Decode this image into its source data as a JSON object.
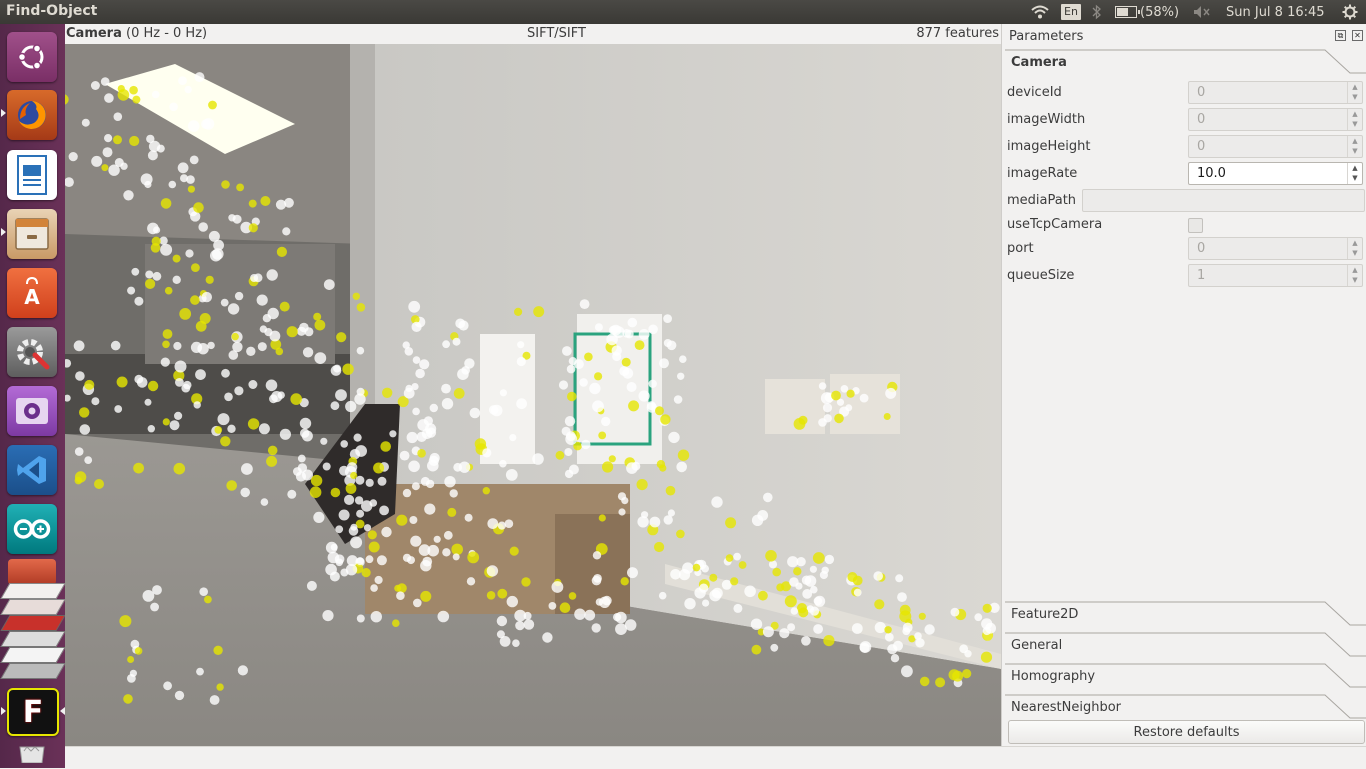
{
  "topbar": {
    "app_title": "Find-Object",
    "keyboard_layout": "En",
    "battery_percent": "(58%)",
    "clock": "Sun Jul 8 16:45"
  },
  "launcher": {
    "apps": [
      {
        "name": "Ubuntu Dash",
        "icon": "ubuntu-logo",
        "color": "#8a3d76"
      },
      {
        "name": "Firefox",
        "icon": "firefox",
        "color": "#e66000"
      },
      {
        "name": "LibreOffice Writer",
        "icon": "writer",
        "color": "#2a71b8"
      },
      {
        "name": "Files",
        "icon": "file-cabinet",
        "color": "#c9733a"
      },
      {
        "name": "Ubuntu Software",
        "icon": "shopping-bag",
        "color": "#e2552b"
      },
      {
        "name": "System Settings",
        "icon": "gear-wrench",
        "color": "#6d6d6d"
      },
      {
        "name": "Webcam",
        "icon": "camera",
        "color": "#8e44ad"
      },
      {
        "name": "Visual Studio Code",
        "icon": "vscode",
        "color": "#0f6fbf"
      },
      {
        "name": "Arduino",
        "icon": "arduino",
        "color": "#00979c"
      },
      {
        "name": "Workspace stack",
        "icon": "stack",
        "color": "#d04030"
      },
      {
        "name": "Find-Object",
        "icon": "find-object",
        "color": "#111111"
      },
      {
        "name": "Trash",
        "icon": "trash",
        "color": "#cccccc"
      }
    ]
  },
  "camera_panel": {
    "title_name": "Camera",
    "title_rate": "(0 Hz - 0 Hz)",
    "detector": "SIFT/SIFT",
    "features": "877 features",
    "feature_colors": {
      "matched": "#e6e600",
      "unmatched": "#ffffff",
      "object_box": "#2aa37e"
    }
  },
  "parameters": {
    "title": "Parameters",
    "open_section": "Camera",
    "rows": [
      {
        "label": "deviceId",
        "value": "0",
        "kind": "spin"
      },
      {
        "label": "imageWidth",
        "value": "0",
        "kind": "spin"
      },
      {
        "label": "imageHeight",
        "value": "0",
        "kind": "spin"
      },
      {
        "label": "imageRate",
        "value": "10.0",
        "kind": "spin-active"
      },
      {
        "label": "mediaPath",
        "value": "",
        "kind": "text"
      },
      {
        "label": "useTcpCamera",
        "value": "",
        "kind": "check"
      },
      {
        "label": "port",
        "value": "0",
        "kind": "spin"
      },
      {
        "label": "queueSize",
        "value": "1",
        "kind": "spin"
      }
    ],
    "sections": [
      "Feature2D",
      "General",
      "Homography",
      "NearestNeighbor"
    ],
    "restore_label": "Restore defaults"
  }
}
